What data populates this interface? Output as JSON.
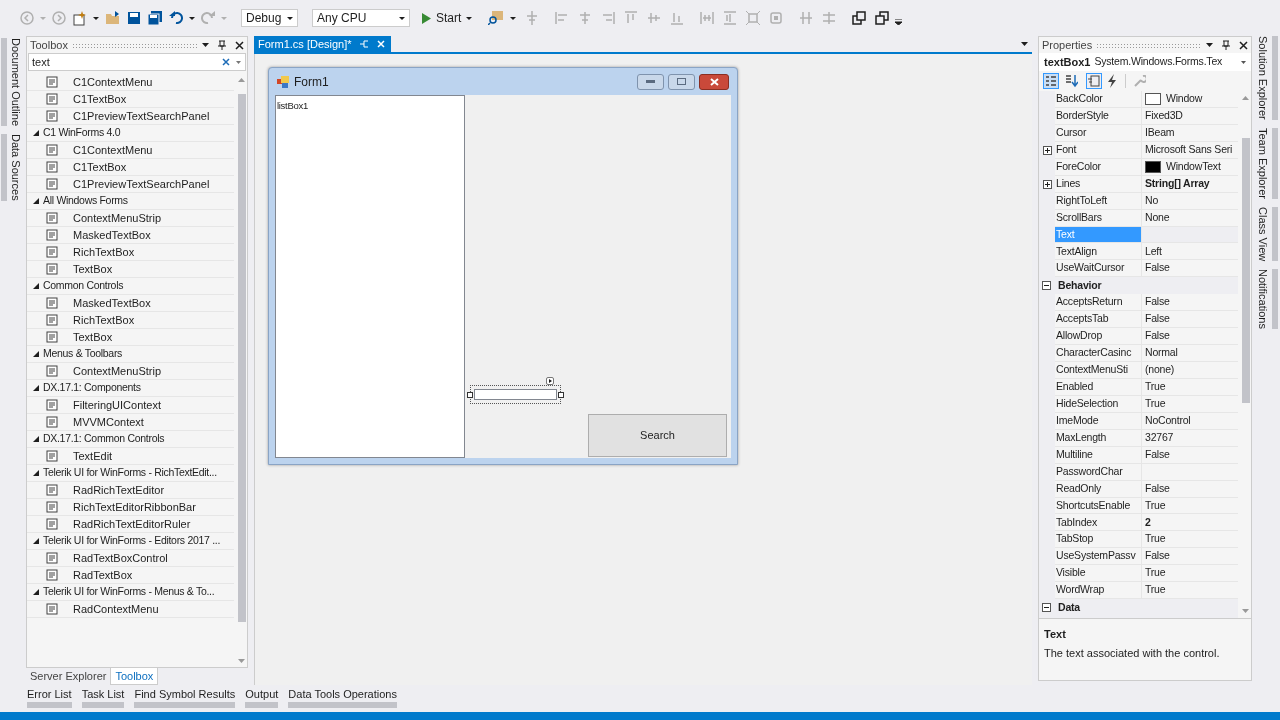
{
  "toolbar": {
    "configuration": "Debug",
    "platform": "Any CPU",
    "start": "Start"
  },
  "left_side_tabs": [
    "Document Outline",
    "Data Sources"
  ],
  "toolbox": {
    "title": "Toolbox",
    "search": {
      "value": "text"
    },
    "entries": [
      {
        "kind": "item",
        "label": "C1ContextMenu"
      },
      {
        "kind": "item",
        "label": "C1TextBox"
      },
      {
        "kind": "item",
        "label": "C1PreviewTextSearchPanel"
      },
      {
        "kind": "group",
        "label": "C1 WinForms 4.0",
        "expanded": true,
        "children": [
          {
            "kind": "item",
            "label": "C1ContextMenu"
          },
          {
            "kind": "item",
            "label": "C1TextBox"
          },
          {
            "kind": "item",
            "label": "C1PreviewTextSearchPanel"
          }
        ]
      },
      {
        "kind": "group",
        "label": "All Windows Forms",
        "expanded": true,
        "children": [
          {
            "kind": "item",
            "label": "ContextMenuStrip"
          },
          {
            "kind": "item",
            "label": "MaskedTextBox"
          },
          {
            "kind": "item",
            "label": "RichTextBox"
          },
          {
            "kind": "item",
            "label": "TextBox"
          }
        ]
      },
      {
        "kind": "group",
        "label": "Common Controls",
        "expanded": true,
        "children": [
          {
            "kind": "item",
            "label": "MaskedTextBox"
          },
          {
            "kind": "item",
            "label": "RichTextBox"
          },
          {
            "kind": "item",
            "label": "TextBox"
          }
        ]
      },
      {
        "kind": "group",
        "label": "Menus & Toolbars",
        "expanded": true,
        "children": [
          {
            "kind": "item",
            "label": "ContextMenuStrip"
          }
        ]
      },
      {
        "kind": "group",
        "label": "DX.17.1: Components",
        "expanded": true,
        "children": [
          {
            "kind": "item",
            "label": "FilteringUIContext"
          },
          {
            "kind": "item",
            "label": "MVVMContext"
          }
        ]
      },
      {
        "kind": "group",
        "label": "DX.17.1: Common Controls",
        "expanded": true,
        "children": [
          {
            "kind": "item",
            "label": "TextEdit"
          }
        ]
      },
      {
        "kind": "group",
        "label": "Telerik UI for WinForms - RichTextEdit...",
        "expanded": true,
        "children": [
          {
            "kind": "item",
            "label": "RadRichTextEditor"
          },
          {
            "kind": "item",
            "label": "RichTextEditorRibbonBar"
          },
          {
            "kind": "item",
            "label": "RadRichTextEditorRuler"
          }
        ]
      },
      {
        "kind": "group",
        "label": "Telerik UI for WinForms - Editors 2017 ...",
        "expanded": true,
        "children": [
          {
            "kind": "item",
            "label": "RadTextBoxControl"
          },
          {
            "kind": "item",
            "label": "RadTextBox"
          }
        ]
      },
      {
        "kind": "group",
        "label": "Telerik UI for WinForms - Menus & To...",
        "expanded": true,
        "children": [
          {
            "kind": "item",
            "label": "RadContextMenu"
          }
        ]
      }
    ],
    "tabs": [
      {
        "label": "Server Explorer",
        "selected": false
      },
      {
        "label": "Toolbox",
        "selected": true
      }
    ]
  },
  "editor_tabs": [
    {
      "label": "Form1.cs [Design]*",
      "selected": true
    }
  ],
  "form": {
    "title": "Form1",
    "listbox": "listBox1",
    "textbox": {
      "selected": true
    },
    "button": "Search"
  },
  "properties": {
    "title": "Properties",
    "object": "textBox1",
    "type": "System.Windows.Forms.Tex",
    "rows": [
      {
        "kind": "property",
        "name": "BackColor",
        "value": "Window",
        "color": "#ffffff",
        "selected": false
      },
      {
        "kind": "property",
        "name": "BorderStyle",
        "value": "Fixed3D",
        "selected": false
      },
      {
        "kind": "property",
        "name": "Cursor",
        "value": "IBeam",
        "selected": false
      },
      {
        "kind": "property",
        "name": "Font",
        "value": "Microsoft Sans Seri",
        "expandable": true,
        "selected": false
      },
      {
        "kind": "property",
        "name": "ForeColor",
        "value": "WindowText",
        "color": "#000000",
        "selected": false
      },
      {
        "kind": "property",
        "name": "Lines",
        "value": "String[] Array",
        "expandable": true,
        "modified": true,
        "selected": false
      },
      {
        "kind": "property",
        "name": "RightToLeft",
        "value": "No",
        "selected": false
      },
      {
        "kind": "property",
        "name": "ScrollBars",
        "value": "None",
        "selected": false
      },
      {
        "kind": "property",
        "name": "Text",
        "selected": true
      },
      {
        "kind": "property",
        "name": "TextAlign",
        "value": "Left",
        "selected": false
      },
      {
        "kind": "property",
        "name": "UseWaitCursor",
        "value": "False",
        "selected": false
      },
      {
        "kind": "category",
        "name": "Behavior",
        "expanded": true
      },
      {
        "kind": "property",
        "name": "AcceptsReturn",
        "value": "False",
        "selected": false
      },
      {
        "kind": "property",
        "name": "AcceptsTab",
        "value": "False",
        "selected": false
      },
      {
        "kind": "property",
        "name": "AllowDrop",
        "value": "False",
        "selected": false
      },
      {
        "kind": "property",
        "name": "CharacterCasinc",
        "value": "Normal",
        "selected": false
      },
      {
        "kind": "property",
        "name": "ContextMenuSti",
        "value": "(none)",
        "selected": false
      },
      {
        "kind": "property",
        "name": "Enabled",
        "value": "True",
        "selected": false
      },
      {
        "kind": "property",
        "name": "HideSelection",
        "value": "True",
        "selected": false
      },
      {
        "kind": "property",
        "name": "ImeMode",
        "value": "NoControl",
        "selected": false
      },
      {
        "kind": "property",
        "name": "MaxLength",
        "value": "32767",
        "selected": false
      },
      {
        "kind": "property",
        "name": "Multiline",
        "value": "False",
        "selected": false
      },
      {
        "kind": "property",
        "name": "PasswordChar",
        "selected": false
      },
      {
        "kind": "property",
        "name": "ReadOnly",
        "value": "False",
        "selected": false
      },
      {
        "kind": "property",
        "name": "ShortcutsEnable",
        "value": "True",
        "selected": false
      },
      {
        "kind": "property",
        "name": "TabIndex",
        "value": "2",
        "modified": true,
        "selected": false
      },
      {
        "kind": "property",
        "name": "TabStop",
        "value": "True",
        "selected": false
      },
      {
        "kind": "property",
        "name": "UseSystemPassv",
        "value": "False",
        "selected": false
      },
      {
        "kind": "property",
        "name": "Visible",
        "value": "True",
        "selected": false
      },
      {
        "kind": "property",
        "name": "WordWrap",
        "value": "True",
        "selected": false
      },
      {
        "kind": "category",
        "name": "Data",
        "expanded": true
      }
    ],
    "description": {
      "title": "Text",
      "text": "The text associated with the control."
    }
  },
  "right_side_tabs": [
    "Solution Explorer",
    "Team Explorer",
    "Class View",
    "Notifications"
  ],
  "bottom_tabs": [
    "Error List",
    "Task List",
    "Find Symbol Results",
    "Output",
    "Data Tools Operations"
  ]
}
